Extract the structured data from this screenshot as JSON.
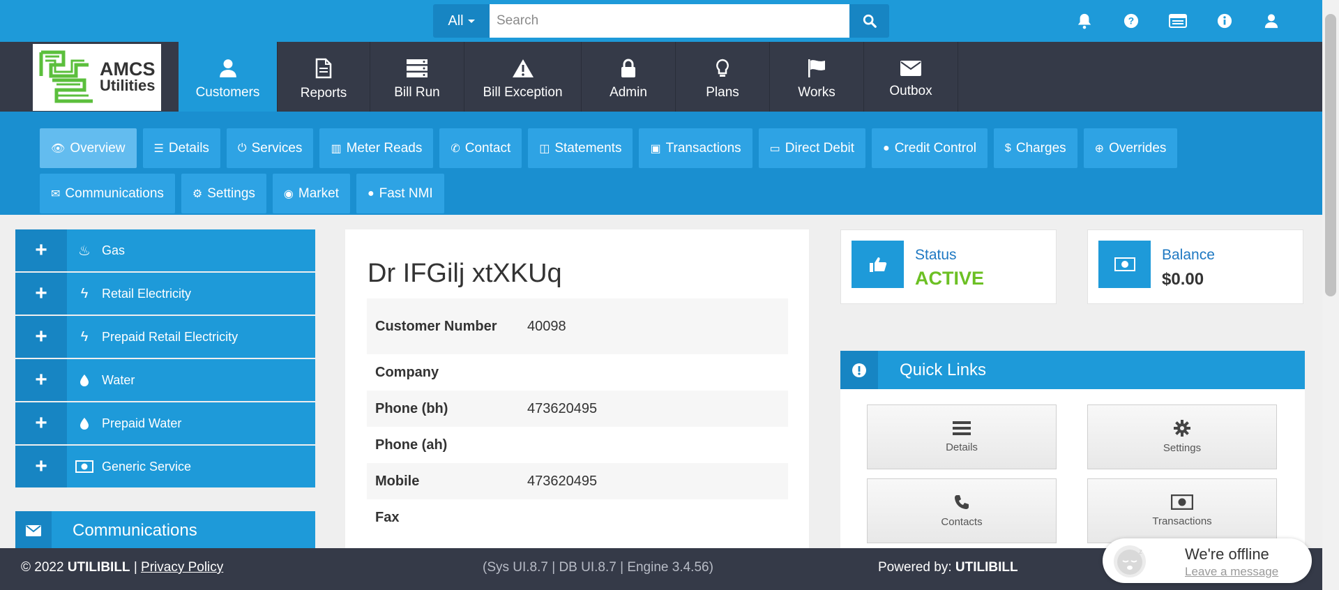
{
  "search": {
    "scope": "All",
    "placeholder": "Search"
  },
  "brand": {
    "logo_line1": "AMCS",
    "logo_line2": "Utilities"
  },
  "nav": [
    {
      "label": "Customers",
      "icon": "user-icon",
      "active": true
    },
    {
      "label": "Reports",
      "icon": "file-icon"
    },
    {
      "label": "Bill Run",
      "icon": "server-icon"
    },
    {
      "label": "Bill Exception",
      "icon": "warning-icon"
    },
    {
      "label": "Admin",
      "icon": "lock-icon"
    },
    {
      "label": "Plans",
      "icon": "lightbulb-icon"
    },
    {
      "label": "Works",
      "icon": "flag-icon"
    },
    {
      "label": "Outbox",
      "icon": "envelope-icon"
    }
  ],
  "tabs": [
    {
      "label": "Overview",
      "icon": "eye-icon",
      "glyph": "👁",
      "active": true
    },
    {
      "label": "Details",
      "icon": "list-icon",
      "glyph": "☰"
    },
    {
      "label": "Services",
      "icon": "power-icon",
      "glyph": "⏻"
    },
    {
      "label": "Meter Reads",
      "icon": "bar-chart-icon",
      "glyph": "▥"
    },
    {
      "label": "Contact",
      "icon": "phone-icon",
      "glyph": "✆"
    },
    {
      "label": "Statements",
      "icon": "columns-icon",
      "glyph": "◫"
    },
    {
      "label": "Transactions",
      "icon": "money-icon",
      "glyph": "▣"
    },
    {
      "label": "Direct Debit",
      "icon": "credit-card-icon",
      "glyph": "▭"
    },
    {
      "label": "Credit Control",
      "icon": "user-icon",
      "glyph": "●"
    },
    {
      "label": "Charges",
      "icon": "dollar-icon",
      "glyph": "$"
    },
    {
      "label": "Overrides",
      "icon": "arrow-circle-icon",
      "glyph": "⊕"
    },
    {
      "label": "Communications",
      "icon": "envelope-icon",
      "glyph": "✉"
    },
    {
      "label": "Settings",
      "icon": "gear-icon",
      "glyph": "⚙"
    },
    {
      "label": "Market",
      "icon": "globe-icon",
      "glyph": "◉"
    },
    {
      "label": "Fast NMI",
      "icon": "user-icon",
      "glyph": "●"
    }
  ],
  "services": [
    {
      "label": "Gas",
      "icon": "fire-icon",
      "glyph": "♨"
    },
    {
      "label": "Retail Electricity",
      "icon": "bolt-icon",
      "glyph": "ϟ"
    },
    {
      "label": "Prepaid Retail Electricity",
      "icon": "bolt-icon",
      "glyph": "ϟ"
    },
    {
      "label": "Water",
      "icon": "drop-icon",
      "glyph": "💧"
    },
    {
      "label": "Prepaid Water",
      "icon": "drop-icon",
      "glyph": "💧"
    },
    {
      "label": "Generic Service",
      "icon": "money-icon",
      "glyph": "▣"
    }
  ],
  "communications": {
    "label": "Communications"
  },
  "customer": {
    "name": "Dr IFGilj xtXKUq",
    "fields": [
      {
        "label": "Customer Number",
        "value": "40098"
      },
      {
        "label": "Company",
        "value": ""
      },
      {
        "label": "Phone (bh)",
        "value": "473620495"
      },
      {
        "label": "Phone (ah)",
        "value": ""
      },
      {
        "label": "Mobile",
        "value": "473620495"
      },
      {
        "label": "Fax",
        "value": ""
      }
    ]
  },
  "status": {
    "title": "Status",
    "value": "ACTIVE",
    "value_color": "#6cc024"
  },
  "balance": {
    "title": "Balance",
    "value": "$0.00"
  },
  "quick_links": {
    "title": "Quick Links",
    "items": [
      {
        "label": "Details",
        "icon": "list-icon"
      },
      {
        "label": "Settings",
        "icon": "gear-icon"
      },
      {
        "label": "Contacts",
        "icon": "phone-icon"
      },
      {
        "label": "Transactions",
        "icon": "money-icon"
      }
    ]
  },
  "footer": {
    "copyright": "© 2022",
    "brand": "UTILIBILL",
    "separator": "|",
    "privacy": "Privacy Policy",
    "versions": "(Sys UI.8.7 | DB UI.8.7 | Engine 3.4.56)",
    "powered_by": "Powered by:",
    "powered_brand": "UTILIBILL"
  },
  "chat": {
    "status": "We're offline",
    "action": "Leave a message"
  },
  "colors": {
    "primary": "#1e9ad9",
    "primary_dark": "#1785c3",
    "nav_bg": "#353a48",
    "active_green": "#6cc024"
  }
}
